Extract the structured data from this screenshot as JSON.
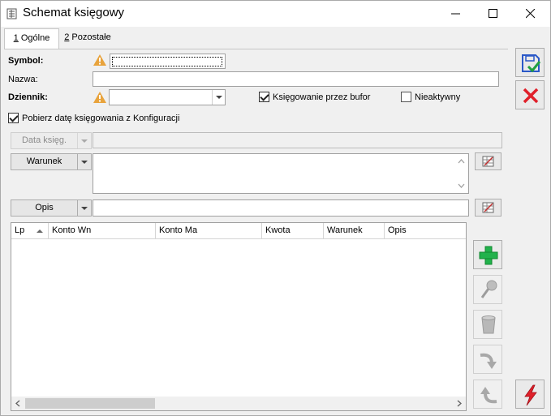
{
  "window": {
    "title": "Schemat księgowy",
    "icon": "document-grid-icon"
  },
  "tabs": [
    {
      "key": "1",
      "label": " Ogólne",
      "active": true
    },
    {
      "key": "2",
      "label": " Pozostałe",
      "active": false
    }
  ],
  "form": {
    "symbol_label": "Symbol:",
    "symbol_value": "",
    "nazwa_label": "Nazwa:",
    "nazwa_value": "",
    "dziennik_label": "Dziennik:",
    "dziennik_value": "",
    "bufor_label": "Księgowanie przez bufor",
    "bufor_checked": true,
    "nieaktywny_label": "Nieaktywny",
    "nieaktywny_checked": false,
    "pobierz_label": "Pobierz datę księgowania z Konfiguracji",
    "pobierz_checked": true,
    "data_kseg_label": "Data księg.",
    "data_kseg_value": "",
    "warunek_label": "Warunek",
    "warunek_value": "",
    "opis_label": "Opis",
    "opis_value": ""
  },
  "grid": {
    "columns": [
      "Lp",
      "Konto Wn",
      "Konto Ma",
      "Kwota",
      "Warunek",
      "Opis"
    ],
    "rows": [],
    "sort_column": "Lp",
    "sort_direction": "ascending"
  },
  "colors": {
    "warning": "#e8a33c",
    "add_green": "#22b24c",
    "cancel_red": "#e0202a",
    "save_blue": "#2a58c8"
  }
}
